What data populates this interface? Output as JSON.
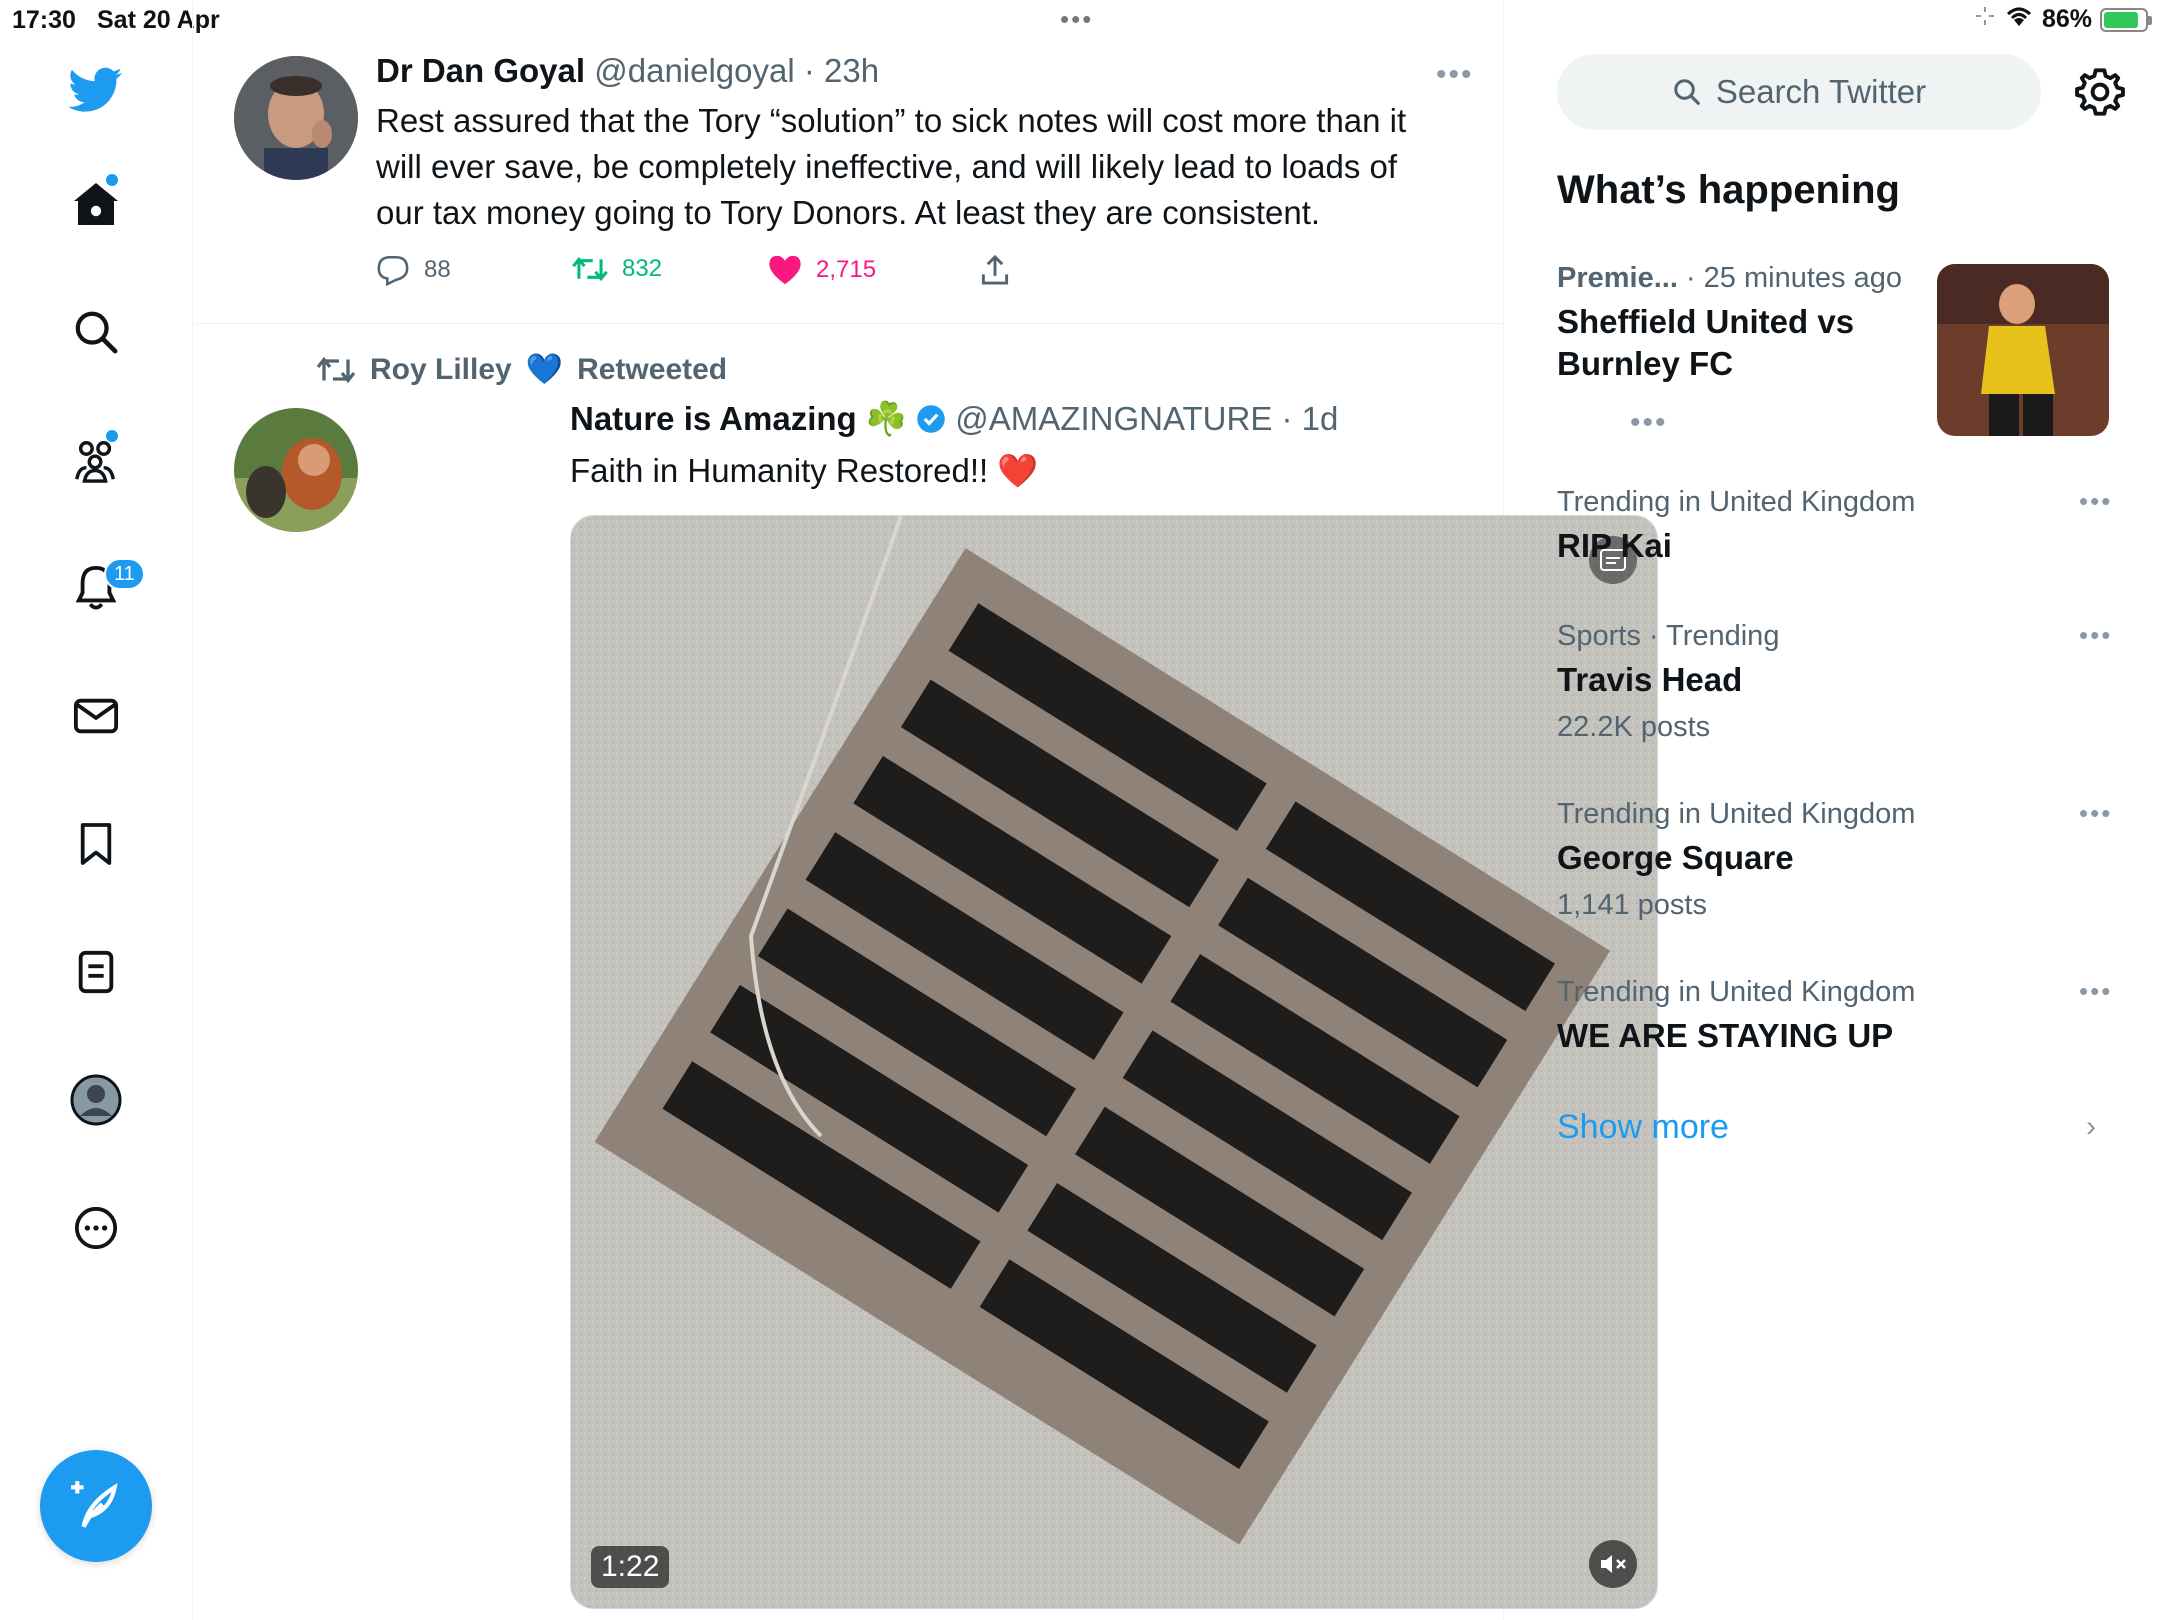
{
  "status_bar": {
    "time": "17:30",
    "date": "Sat 20 Apr",
    "battery": "86%",
    "battery_level": 0.86,
    "center_dots": "•••"
  },
  "nav": {
    "items": [
      {
        "name": "twitter-logo",
        "label": "Twitter"
      },
      {
        "name": "home",
        "label": "Home"
      },
      {
        "name": "explore",
        "label": "Explore"
      },
      {
        "name": "communities",
        "label": "Communities"
      },
      {
        "name": "notifications",
        "label": "Notifications"
      },
      {
        "name": "messages",
        "label": "Messages"
      },
      {
        "name": "bookmarks",
        "label": "Bookmarks"
      },
      {
        "name": "lists",
        "label": "Lists"
      },
      {
        "name": "profile",
        "label": "Profile"
      },
      {
        "name": "more",
        "label": "More"
      }
    ],
    "notification_count": "11"
  },
  "tweets": [
    {
      "name": "Dr Dan Goyal",
      "handle": "@danielgoyal",
      "sep": " · ",
      "time": "23h",
      "text": "Rest assured that the Tory “solution” to sick notes will cost more than it will ever save, be completely ineffective, and will likely lead to loads of our tax money going to Tory Donors. At least they are consistent.",
      "replies": "88",
      "retweets": "832",
      "likes": "2,715",
      "more": "•••"
    },
    {
      "retweeted_by": "Roy Lilley",
      "retweeted_emoji": "💙",
      "retweeted_label": "Retweeted",
      "name": "Nature is Amazing",
      "name_emoji": "☘️",
      "handle": "@AMAZINGNATURE",
      "sep": " · ",
      "time": "1d",
      "text": "Faith in Humanity Restored!!",
      "text_emoji": "❤️",
      "video_duration": "1:22",
      "more": "•••"
    }
  ],
  "sidebar": {
    "search_placeholder": "Search Twitter",
    "title": "What’s happening",
    "featured": {
      "category": "Premie...",
      "time": " · 25 minutes ago",
      "name": "Sheffield United vs Burnley FC"
    },
    "trends": [
      {
        "category": "Trending in United Kingdom",
        "name": "RIP Kai",
        "count": ""
      },
      {
        "category": "Sports · Trending",
        "name": "Travis Head",
        "count": "22.2K posts"
      },
      {
        "category": "Trending in United Kingdom",
        "name": "George Square",
        "count": "1,141 posts"
      },
      {
        "category": "Trending in United Kingdom",
        "name": "WE ARE STAYING UP",
        "count": ""
      }
    ],
    "more_dots": "•••",
    "show_more": "Show more",
    "chevron": "›"
  },
  "colors": {
    "accent": "#1d9bf0",
    "retweet": "#00ba7c",
    "like": "#f91880",
    "secondary_text": "#536471"
  }
}
